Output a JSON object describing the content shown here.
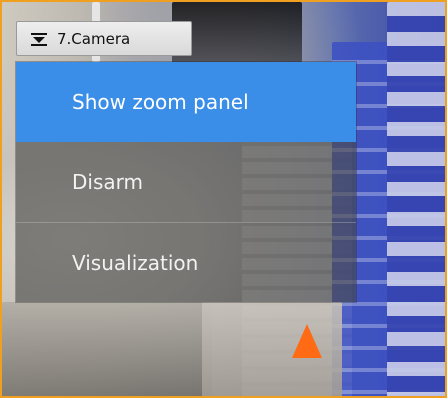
{
  "camera": {
    "title": "7.Camera",
    "menu_icon": "dropdown-menu-icon"
  },
  "context_menu": {
    "items": [
      {
        "label": "Show zoom panel",
        "active": true
      },
      {
        "label": "Disarm",
        "active": false
      },
      {
        "label": "Visualization",
        "active": false
      }
    ]
  },
  "colors": {
    "highlight": "#3b8ee8",
    "frame_border": "#f0a020"
  }
}
